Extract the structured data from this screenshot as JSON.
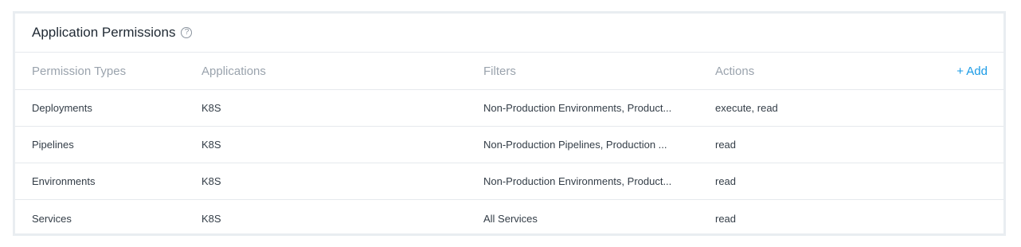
{
  "panel": {
    "title": "Application Permissions",
    "help_icon": "?"
  },
  "table": {
    "headers": {
      "type": "Permission Types",
      "applications": "Applications",
      "filters": "Filters",
      "actions": "Actions"
    },
    "add_label": "+ Add",
    "rows": [
      {
        "type": "Deployments",
        "applications": "K8S",
        "filters": "Non-Production Environments, Product...",
        "actions": "execute, read"
      },
      {
        "type": "Pipelines",
        "applications": "K8S",
        "filters": "Non-Production Pipelines, Production ...",
        "actions": "read"
      },
      {
        "type": "Environments",
        "applications": "K8S",
        "filters": "Non-Production Environments, Product...",
        "actions": "read"
      },
      {
        "type": "Services",
        "applications": "K8S",
        "filters": "All Services",
        "actions": "read"
      }
    ]
  },
  "colors": {
    "accent": "#1a9be6",
    "header_text": "#9aa3ad",
    "body_text": "#333d47",
    "border": "#e6e9ed"
  }
}
